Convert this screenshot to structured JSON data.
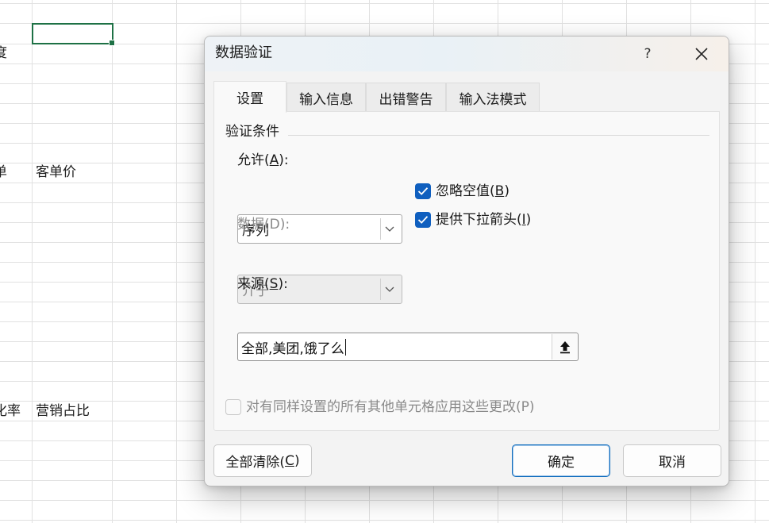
{
  "sheet": {
    "cells": {
      "r1": "度",
      "r2a": "单",
      "r2b": "客单价",
      "r3a": "化率",
      "r3b": "营销占比"
    }
  },
  "dialog": {
    "title": "数据验证",
    "help_label": "?",
    "tabs": [
      {
        "label": "设置"
      },
      {
        "label": "输入信息"
      },
      {
        "label": "出错警告"
      },
      {
        "label": "输入法模式"
      }
    ],
    "group_title": "验证条件",
    "allow": {
      "label_pre": "允许(",
      "label_key": "A",
      "label_post": "):",
      "value": "序列"
    },
    "ignore_blank": {
      "label_pre": "忽略空值(",
      "label_key": "B",
      "label_post": ")",
      "checked": true
    },
    "dropdown_arrow": {
      "label_pre": "提供下拉箭头(",
      "label_key": "I",
      "label_post": ")",
      "checked": true
    },
    "data": {
      "label": "数据(D):",
      "value": "介于",
      "enabled": false
    },
    "source": {
      "label_pre": "来源(",
      "label_key": "S",
      "label_post": "):",
      "value": "全部,美团,饿了么"
    },
    "apply_all": {
      "label": "对有同样设置的所有其他单元格应用这些更改(P)",
      "checked": false,
      "enabled": false
    },
    "buttons": {
      "clear_all": {
        "label_pre": "全部清除(",
        "label_key": "C",
        "label_post": ")"
      },
      "ok": "确定",
      "cancel": "取消"
    },
    "colors": {
      "accent": "#0f5fbf",
      "sheet_select": "#1e7145"
    }
  }
}
